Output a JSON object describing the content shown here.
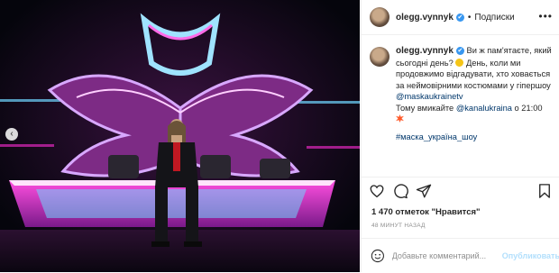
{
  "header": {
    "username": "olegg.vynnyk",
    "verified_mark": "✔",
    "separator": "•",
    "follow_label": "Подписки",
    "more_label": "•••"
  },
  "media": {
    "prev_label": "‹"
  },
  "caption": {
    "username": "olegg.vynnyk",
    "verified_mark": "✔",
    "text_1": " Ви ж пам'ятаєте, який сьогодні день? ",
    "text_2": " День, коли ми продовжимо відгадувати, хто ховається за неймовірними костюмами у гіпершоу ",
    "mention_1": "@maskaukrainetv",
    "text_3": "Тому вмикайте ",
    "mention_2": "@kanalukraina",
    "text_4": " о 21:00",
    "hashtag": "#маска_україна_шоу"
  },
  "actions": {
    "like": "heart-icon",
    "comment": "comment-icon",
    "share": "share-icon",
    "save": "bookmark-icon"
  },
  "likes": "1 470 отметок \"Нравится\"",
  "timestamp": "48 минут назад",
  "comment": {
    "placeholder": "Добавьте комментарий...",
    "publish_label": "Опубликовать"
  },
  "colors": {
    "link": "#00376b",
    "verified": "#3897f0",
    "publish_disabled": "#b2dffc",
    "stage_magenta": "#ff2bd6",
    "stage_cyan": "#6fd6ff"
  }
}
